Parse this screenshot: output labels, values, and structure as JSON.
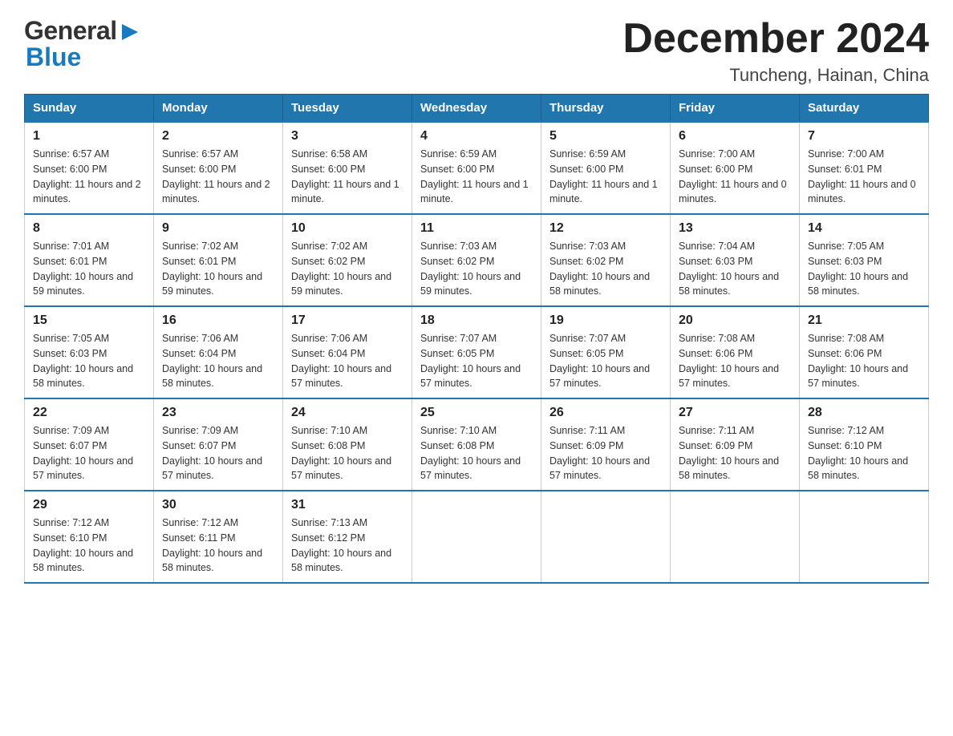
{
  "header": {
    "logo_general": "General",
    "logo_blue": "Blue",
    "month_title": "December 2024",
    "location": "Tuncheng, Hainan, China"
  },
  "weekdays": [
    "Sunday",
    "Monday",
    "Tuesday",
    "Wednesday",
    "Thursday",
    "Friday",
    "Saturday"
  ],
  "weeks": [
    [
      {
        "day": "1",
        "sunrise": "Sunrise: 6:57 AM",
        "sunset": "Sunset: 6:00 PM",
        "daylight": "Daylight: 11 hours and 2 minutes."
      },
      {
        "day": "2",
        "sunrise": "Sunrise: 6:57 AM",
        "sunset": "Sunset: 6:00 PM",
        "daylight": "Daylight: 11 hours and 2 minutes."
      },
      {
        "day": "3",
        "sunrise": "Sunrise: 6:58 AM",
        "sunset": "Sunset: 6:00 PM",
        "daylight": "Daylight: 11 hours and 1 minute."
      },
      {
        "day": "4",
        "sunrise": "Sunrise: 6:59 AM",
        "sunset": "Sunset: 6:00 PM",
        "daylight": "Daylight: 11 hours and 1 minute."
      },
      {
        "day": "5",
        "sunrise": "Sunrise: 6:59 AM",
        "sunset": "Sunset: 6:00 PM",
        "daylight": "Daylight: 11 hours and 1 minute."
      },
      {
        "day": "6",
        "sunrise": "Sunrise: 7:00 AM",
        "sunset": "Sunset: 6:00 PM",
        "daylight": "Daylight: 11 hours and 0 minutes."
      },
      {
        "day": "7",
        "sunrise": "Sunrise: 7:00 AM",
        "sunset": "Sunset: 6:01 PM",
        "daylight": "Daylight: 11 hours and 0 minutes."
      }
    ],
    [
      {
        "day": "8",
        "sunrise": "Sunrise: 7:01 AM",
        "sunset": "Sunset: 6:01 PM",
        "daylight": "Daylight: 10 hours and 59 minutes."
      },
      {
        "day": "9",
        "sunrise": "Sunrise: 7:02 AM",
        "sunset": "Sunset: 6:01 PM",
        "daylight": "Daylight: 10 hours and 59 minutes."
      },
      {
        "day": "10",
        "sunrise": "Sunrise: 7:02 AM",
        "sunset": "Sunset: 6:02 PM",
        "daylight": "Daylight: 10 hours and 59 minutes."
      },
      {
        "day": "11",
        "sunrise": "Sunrise: 7:03 AM",
        "sunset": "Sunset: 6:02 PM",
        "daylight": "Daylight: 10 hours and 59 minutes."
      },
      {
        "day": "12",
        "sunrise": "Sunrise: 7:03 AM",
        "sunset": "Sunset: 6:02 PM",
        "daylight": "Daylight: 10 hours and 58 minutes."
      },
      {
        "day": "13",
        "sunrise": "Sunrise: 7:04 AM",
        "sunset": "Sunset: 6:03 PM",
        "daylight": "Daylight: 10 hours and 58 minutes."
      },
      {
        "day": "14",
        "sunrise": "Sunrise: 7:05 AM",
        "sunset": "Sunset: 6:03 PM",
        "daylight": "Daylight: 10 hours and 58 minutes."
      }
    ],
    [
      {
        "day": "15",
        "sunrise": "Sunrise: 7:05 AM",
        "sunset": "Sunset: 6:03 PM",
        "daylight": "Daylight: 10 hours and 58 minutes."
      },
      {
        "day": "16",
        "sunrise": "Sunrise: 7:06 AM",
        "sunset": "Sunset: 6:04 PM",
        "daylight": "Daylight: 10 hours and 58 minutes."
      },
      {
        "day": "17",
        "sunrise": "Sunrise: 7:06 AM",
        "sunset": "Sunset: 6:04 PM",
        "daylight": "Daylight: 10 hours and 57 minutes."
      },
      {
        "day": "18",
        "sunrise": "Sunrise: 7:07 AM",
        "sunset": "Sunset: 6:05 PM",
        "daylight": "Daylight: 10 hours and 57 minutes."
      },
      {
        "day": "19",
        "sunrise": "Sunrise: 7:07 AM",
        "sunset": "Sunset: 6:05 PM",
        "daylight": "Daylight: 10 hours and 57 minutes."
      },
      {
        "day": "20",
        "sunrise": "Sunrise: 7:08 AM",
        "sunset": "Sunset: 6:06 PM",
        "daylight": "Daylight: 10 hours and 57 minutes."
      },
      {
        "day": "21",
        "sunrise": "Sunrise: 7:08 AM",
        "sunset": "Sunset: 6:06 PM",
        "daylight": "Daylight: 10 hours and 57 minutes."
      }
    ],
    [
      {
        "day": "22",
        "sunrise": "Sunrise: 7:09 AM",
        "sunset": "Sunset: 6:07 PM",
        "daylight": "Daylight: 10 hours and 57 minutes."
      },
      {
        "day": "23",
        "sunrise": "Sunrise: 7:09 AM",
        "sunset": "Sunset: 6:07 PM",
        "daylight": "Daylight: 10 hours and 57 minutes."
      },
      {
        "day": "24",
        "sunrise": "Sunrise: 7:10 AM",
        "sunset": "Sunset: 6:08 PM",
        "daylight": "Daylight: 10 hours and 57 minutes."
      },
      {
        "day": "25",
        "sunrise": "Sunrise: 7:10 AM",
        "sunset": "Sunset: 6:08 PM",
        "daylight": "Daylight: 10 hours and 57 minutes."
      },
      {
        "day": "26",
        "sunrise": "Sunrise: 7:11 AM",
        "sunset": "Sunset: 6:09 PM",
        "daylight": "Daylight: 10 hours and 57 minutes."
      },
      {
        "day": "27",
        "sunrise": "Sunrise: 7:11 AM",
        "sunset": "Sunset: 6:09 PM",
        "daylight": "Daylight: 10 hours and 58 minutes."
      },
      {
        "day": "28",
        "sunrise": "Sunrise: 7:12 AM",
        "sunset": "Sunset: 6:10 PM",
        "daylight": "Daylight: 10 hours and 58 minutes."
      }
    ],
    [
      {
        "day": "29",
        "sunrise": "Sunrise: 7:12 AM",
        "sunset": "Sunset: 6:10 PM",
        "daylight": "Daylight: 10 hours and 58 minutes."
      },
      {
        "day": "30",
        "sunrise": "Sunrise: 7:12 AM",
        "sunset": "Sunset: 6:11 PM",
        "daylight": "Daylight: 10 hours and 58 minutes."
      },
      {
        "day": "31",
        "sunrise": "Sunrise: 7:13 AM",
        "sunset": "Sunset: 6:12 PM",
        "daylight": "Daylight: 10 hours and 58 minutes."
      },
      null,
      null,
      null,
      null
    ]
  ]
}
